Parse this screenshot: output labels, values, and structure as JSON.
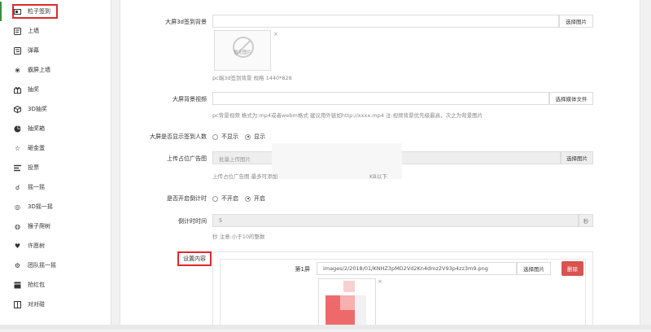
{
  "sidebar": {
    "items": [
      {
        "label": "粒子签到",
        "icon": "image-icon"
      },
      {
        "label": "上墙",
        "icon": "message-icon"
      },
      {
        "label": "弹幕",
        "icon": "bullet-chat-icon"
      },
      {
        "label": "霸屏上墙",
        "icon": "award-icon"
      },
      {
        "label": "抽奖",
        "icon": "gift-icon"
      },
      {
        "label": "3D抽奖",
        "icon": "cube-icon"
      },
      {
        "label": "抽奖箱",
        "icon": "pie-icon"
      },
      {
        "label": "砸金蛋",
        "icon": "star-icon"
      },
      {
        "label": "投票",
        "icon": "list-icon"
      },
      {
        "label": "摇一摇",
        "icon": "shake-icon"
      },
      {
        "label": "3D摇一摇",
        "icon": "cube-shake-icon"
      },
      {
        "label": "猴子爬树",
        "icon": "monkey-icon"
      },
      {
        "label": "许愿树",
        "icon": "heart-icon"
      },
      {
        "label": "团队摇一摇",
        "icon": "team-icon"
      },
      {
        "label": "抢红包",
        "icon": "red-packet-icon"
      },
      {
        "label": "对对碰",
        "icon": "pair-icon"
      }
    ]
  },
  "form": {
    "bg3d": {
      "label": "大屏3d签到背景",
      "button": "选择图片",
      "help": "pc端3d签到背景 规格 1440*828",
      "noimg": "暂无图片"
    },
    "video": {
      "label": "大屏背景视频",
      "button": "选择媒体文件",
      "help": "pc背景视频 格式为:mp4或者webm格式 建议用外链如http://xxxx.mp4 注:视频背景优先级最高，次之为背景图片"
    },
    "show_count": {
      "label": "大屏是否显示签到人数",
      "options": [
        "不显示",
        "显示"
      ],
      "selected": 1
    },
    "ad": {
      "label": "上传占位广告图",
      "placeholder": "批量上传图片",
      "help_left": "上传占位广告图 最多可添加",
      "help_right": "KB以下"
    },
    "countdown_enable": {
      "label": "是否开启倒计时",
      "options": [
        "不开启",
        "开启"
      ],
      "selected": 1
    },
    "countdown": {
      "label": "倒计时时间",
      "value": "5",
      "unit": "秒",
      "help": "秒 注意:小于10的整数"
    },
    "content": {
      "label": "设置内容",
      "screen_label": "第1屏",
      "path": "images/2/2018/01/KNHZ3pMD2Vd2Kn4dmz2V93p4zz3m9.png",
      "button": "选择图片",
      "delete": "删除"
    }
  },
  "colors": {
    "accent_red": "#e0282e",
    "delete": "#d9534f",
    "active_bar": "#3c8d3c"
  }
}
